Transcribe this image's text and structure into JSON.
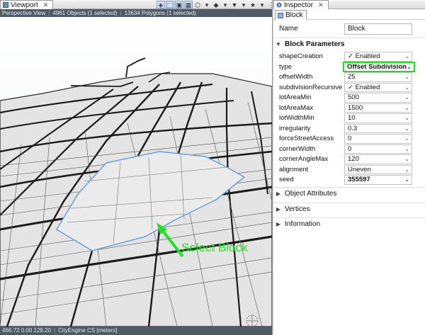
{
  "viewport": {
    "tab_label": "Viewport",
    "info": [
      "Perspective View",
      "4961 Objects (1 selected)",
      "13634 Polygons (1 selected)"
    ],
    "toolbar_icons": [
      "view-mode-icon",
      "selection-icon",
      "camera-icon",
      "grid-icon",
      "wireframe-icon",
      "layers-icon",
      "bookmark-icon",
      "star-icon"
    ],
    "status": [
      "466.72 0.00 128.20",
      "CityEngine CS [meters]"
    ],
    "callout": "Select Block",
    "callout_color": "#22e022",
    "selection_outline_color": "#6aa0d8"
  },
  "inspector": {
    "tab_label": "Inspector",
    "subtab_label": "Block",
    "name_label": "Name",
    "name_value": "Block",
    "section_block_params": "Block Parameters",
    "params": [
      {
        "label": "shapeCreation",
        "value": "✓ Enabled",
        "dropdown": true
      },
      {
        "label": "type",
        "value": "Offset Subdivision",
        "dropdown": true
      },
      {
        "label": "offsetWidth",
        "value": "25",
        "dropdown": true
      },
      {
        "label": "subdivisionRecursive",
        "value": "✓ Enabled",
        "dropdown": true
      },
      {
        "label": "lotAreaMin",
        "value": "500",
        "dropdown": true
      },
      {
        "label": "lotAreaMax",
        "value": "1500",
        "dropdown": true
      },
      {
        "label": "lotWidthMin",
        "value": "10",
        "dropdown": true
      },
      {
        "label": "irregularity",
        "value": "0.3",
        "dropdown": true
      },
      {
        "label": "forceStreetAccess",
        "value": "0",
        "dropdown": true
      },
      {
        "label": "cornerWidth",
        "value": "0",
        "dropdown": true
      },
      {
        "label": "cornerAngleMax",
        "value": "120",
        "dropdown": true
      },
      {
        "label": "alignment",
        "value": "Uneven",
        "dropdown": true
      },
      {
        "label": "seed",
        "value": "355597",
        "dropdown": true
      }
    ],
    "highlight_color": "#22dd22",
    "section_object_attributes": "Object Attributes",
    "section_vertices": "Vertices",
    "section_information": "Information"
  }
}
